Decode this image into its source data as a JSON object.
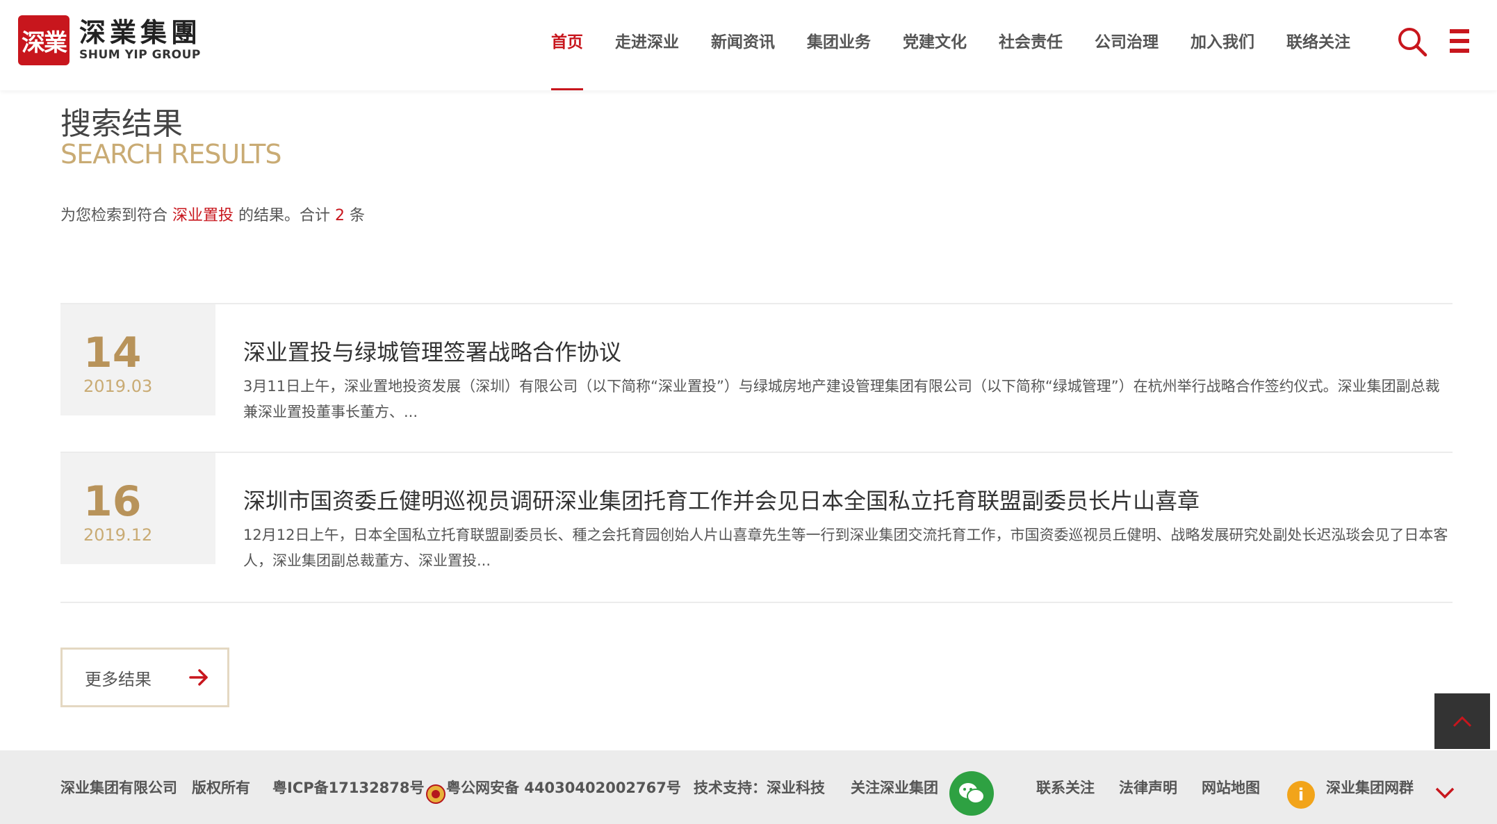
{
  "header": {
    "logo_seal": "深業",
    "logo_cn": "深業集團",
    "logo_en": "SHUM YIP GROUP",
    "nav": [
      "首页",
      "走进深业",
      "新闻资讯",
      "集团业务",
      "党建文化",
      "社会责任",
      "公司治理",
      "加入我们",
      "联络关注"
    ],
    "active_nav": "首页",
    "accent_color": "#c8161d"
  },
  "page": {
    "title_cn": "搜索结果",
    "title_en": "SEARCH RESULTS",
    "summary_prefix": "为您检索到符合",
    "keyword": "深业置投",
    "summary_middle": "的结果。合计",
    "count": "2",
    "summary_suffix": "条"
  },
  "results": [
    {
      "day": "14",
      "year_month": "2019.03",
      "title": "深业置投与绿城管理签署战略合作协议",
      "desc": "3月11日上午，深业置地投资发展（深圳）有限公司（以下简称“深业置投”）与绿城房地产建设管理集团有限公司（以下简称“绿城管理”）在杭州举行战略合作签约仪式。深业集团副总裁兼深业置投董事长董方、..."
    },
    {
      "day": "16",
      "year_month": "2019.12",
      "title": "深圳市国资委丘健明巡视员调研深业集团托育工作并会见日本全国私立托育联盟副委员长片山喜章",
      "desc": "12月12日上午，日本全国私立托育联盟副委员长、種之会托育园创始人片山喜章先生等一行到深业集团交流托育工作，市国资委巡视员丘健明、战略发展研究处副处长迟泓琰会见了日本客人，深业集团副总裁董方、深业置投..."
    }
  ],
  "more_button": "更多结果",
  "footer": {
    "company": "深业集团有限公司",
    "rights": "版权所有",
    "icp": "粤ICP备17132878号",
    "police": "粤公网安备 44030402002767号",
    "tech_support": "技术支持：深业科技",
    "follow": "关注深业集团",
    "contact": "联系关注",
    "legal": "法律声明",
    "sitemap": "网站地图",
    "site_group": "深业集团网群"
  }
}
